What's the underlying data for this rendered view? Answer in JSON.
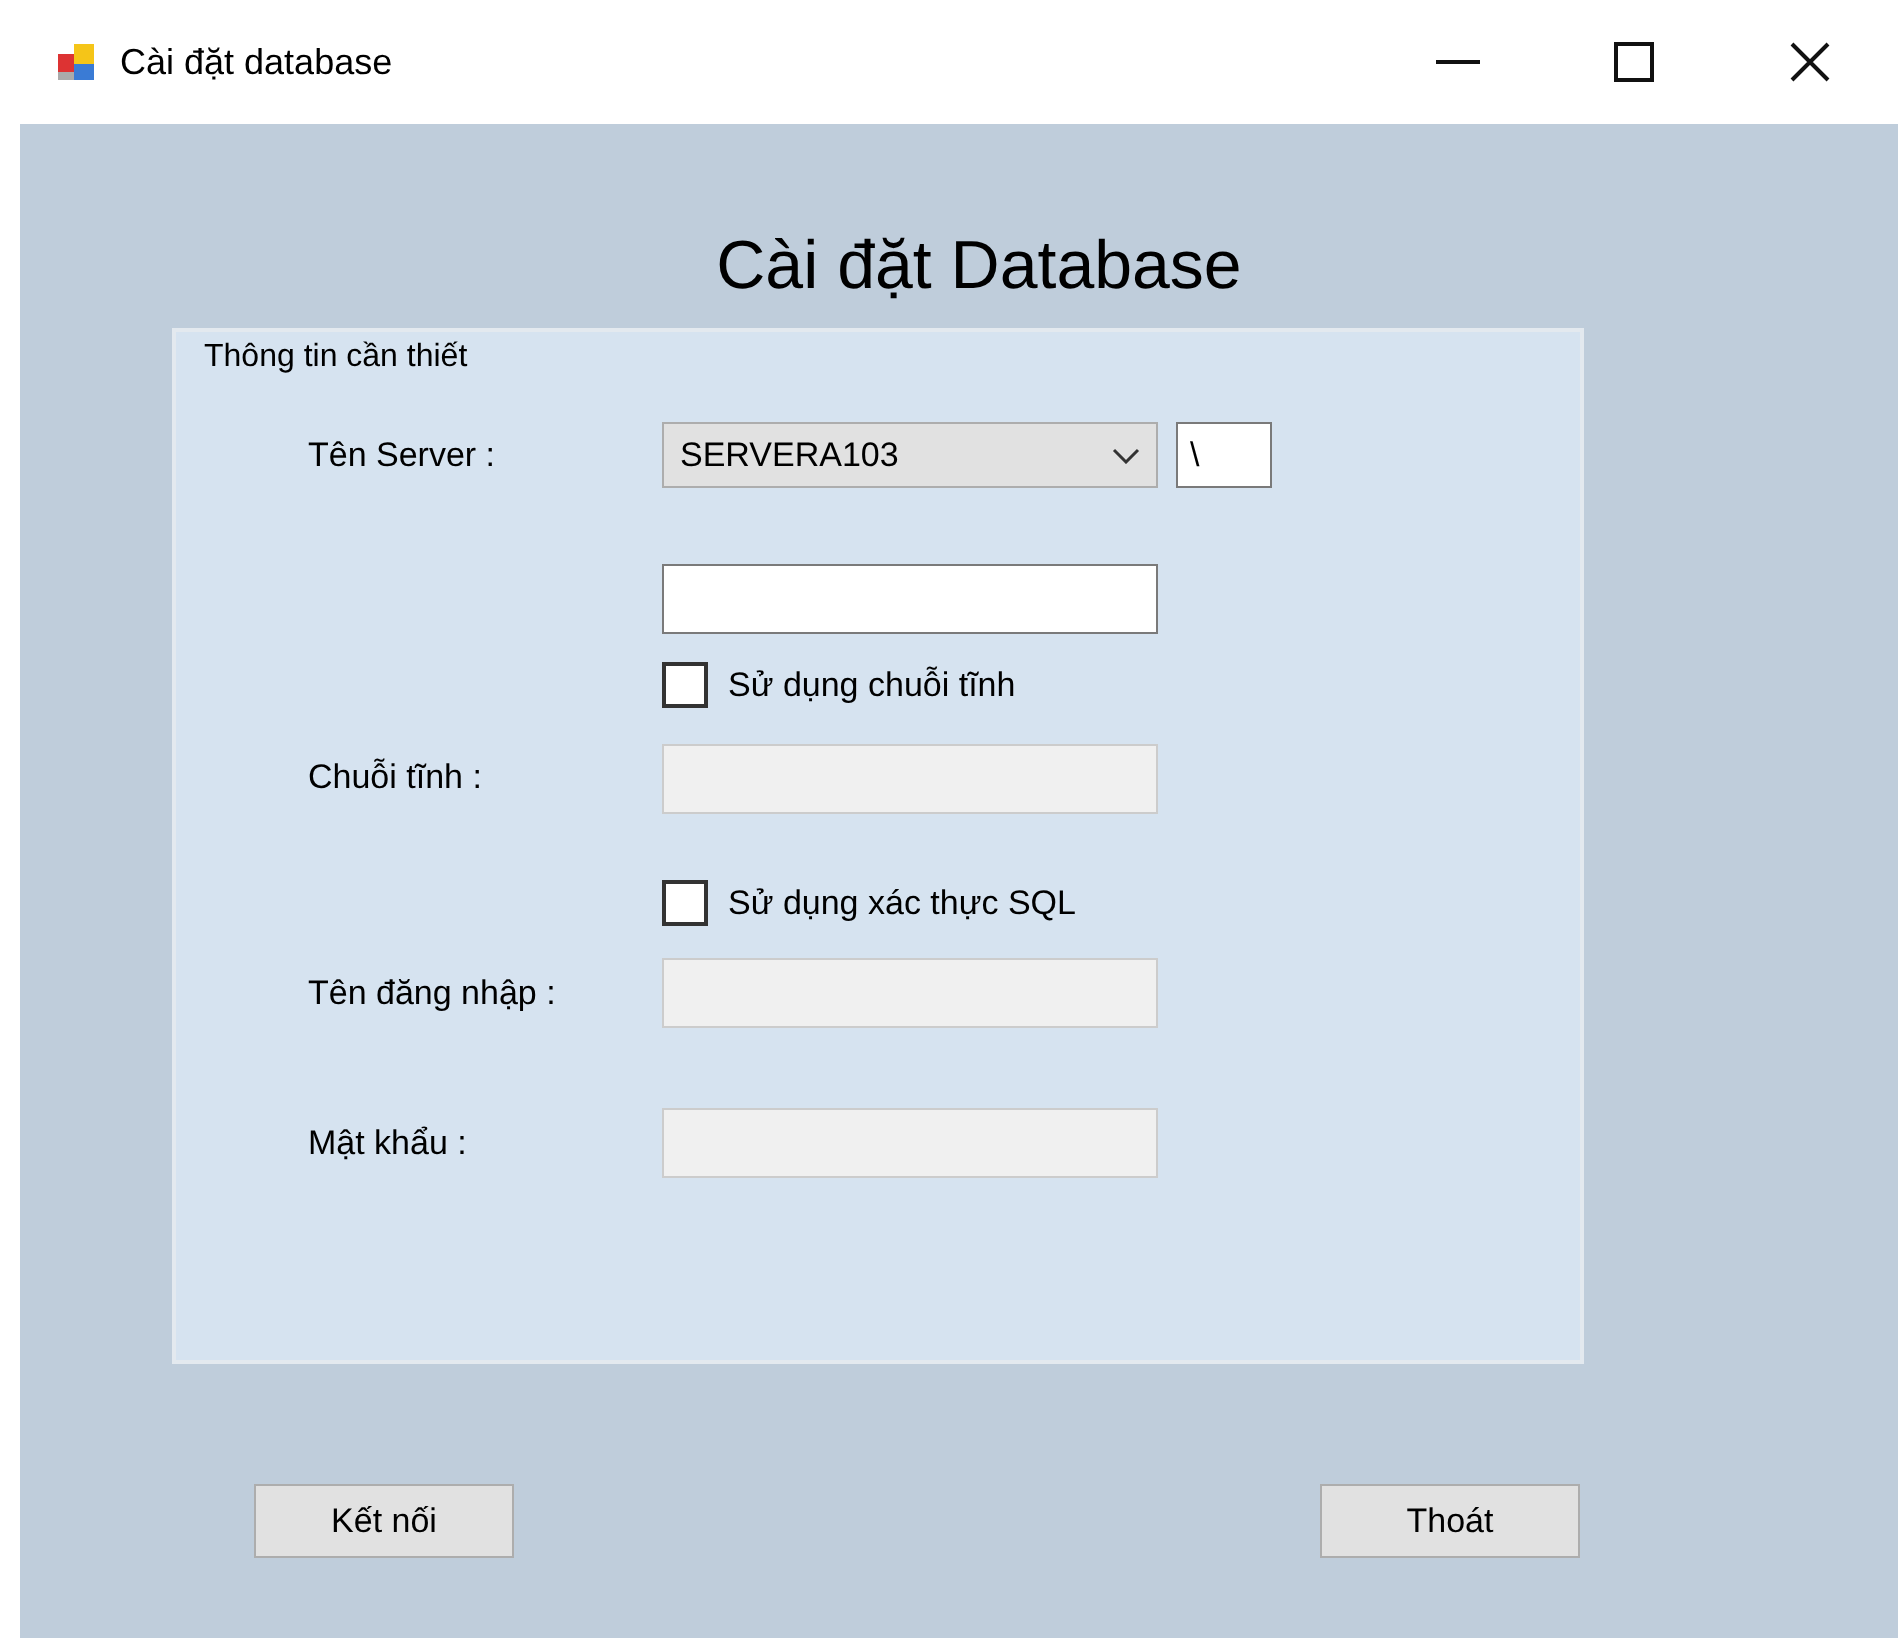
{
  "window": {
    "title": "Cài đặt database"
  },
  "heading": "Cài đặt Database",
  "group": {
    "title": "Thông tin cần thiết",
    "rows": [
      {
        "kind": "combo",
        "label": "Tên Server :",
        "value": "SERVERA103",
        "extra_value": "\\",
        "disabled": false
      },
      {
        "kind": "text",
        "value": "",
        "disabled": false
      },
      {
        "kind": "check",
        "label": "Sử dụng chuỗi tĩnh",
        "checked": false
      },
      {
        "kind": "text",
        "label": "Chuỗi tĩnh :",
        "disabled": true
      },
      {
        "kind": "check",
        "label": "Sử dụng xác thực SQL",
        "checked": false
      },
      {
        "kind": "text",
        "label": "Tên đăng nhập :",
        "disabled": true
      },
      {
        "kind": "text",
        "label": "Mật khẩu :",
        "disabled": true
      }
    ]
  },
  "buttons": [
    {
      "label": "Kết nối"
    },
    {
      "label": "Thoát"
    }
  ]
}
